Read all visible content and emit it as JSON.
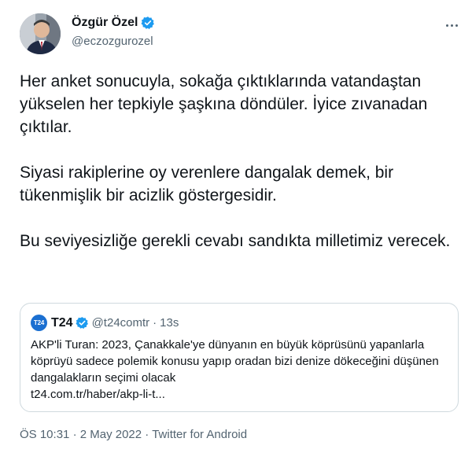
{
  "author": {
    "name": "Özgür Özel",
    "handle": "@eczozgurozel"
  },
  "tweet": {
    "paragraphs": [
      "Her anket sonucuyla, sokağa çıktıklarında vatandaştan yükselen her tepkiyle şaşkına döndüler. İyice zıvanadan çıktılar.",
      "Siyasi rakiplerine oy verenlere dangalak demek, bir tükenmişlik bir acizlik göstergesidir.",
      "Bu seviyesizliğe gerekli cevabı sandıkta milletimiz verecek."
    ]
  },
  "quote": {
    "avatar_text": "T24",
    "name": "T24",
    "handle": "@t24comtr",
    "separator": "·",
    "time": "13s",
    "text": "AKP'li Turan: 2023, Çanakkale'ye dünyanın en büyük köprüsünü yapanlarla köprüyü sadece polemik konusu yapıp oradan bizi denize dökeceğini düşünen dangalakların seçimi olacak",
    "link": "t24.com.tr/haber/akp-li-t..."
  },
  "meta": {
    "time": "ÖS 10:31",
    "sep1": "·",
    "date": "2 May 2022",
    "sep2": "·",
    "source": "Twitter for Android"
  },
  "colors": {
    "text": "#0f1419",
    "secondary": "#536471",
    "verified": "#1d9bf0",
    "border": "#cfd9de"
  },
  "icons": {
    "verified": "verified-badge-icon",
    "more": "more-options-icon"
  }
}
